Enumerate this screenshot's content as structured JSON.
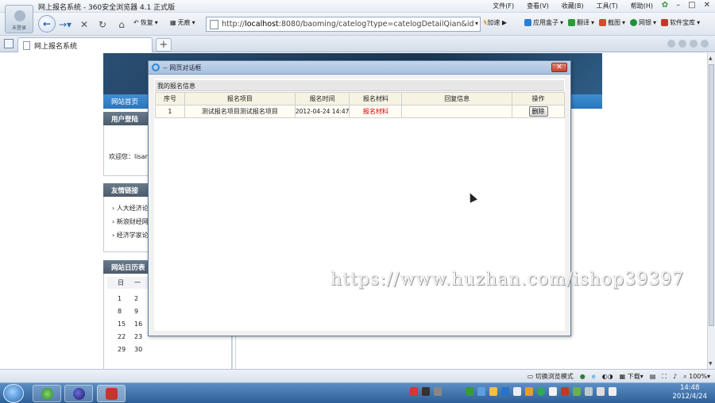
{
  "browser": {
    "title": "网上报名系统 - 360安全浏览器 4.1 正式版",
    "menu": [
      "文件(F)",
      "查看(V)",
      "收藏(B)",
      "工具(T)",
      "帮助(H)"
    ],
    "avatar_label": "未登录",
    "back_icon": "back-arrow-icon",
    "forward_icon": "forward-arrow-icon",
    "stop_glyph": "✕",
    "refresh_glyph": "↻",
    "home_glyph": "⌂",
    "restore_label": "恢复",
    "trace_label": "无痕",
    "address_prefix": "http://",
    "address_host": "localhost",
    "address_rest": ":8080/baoming/catelog?type=catelogDetailQian&id=",
    "speedup_label": "加速",
    "plugins": [
      {
        "label": "应用盒子",
        "color": "#2a7fd4"
      },
      {
        "label": "翻译",
        "color": "#2c9a3a"
      },
      {
        "label": "截图",
        "color": "#d64b2b"
      },
      {
        "label": "网银",
        "color": "#1e8f3a"
      },
      {
        "label": "软件宝库",
        "color": "#c0392b"
      }
    ],
    "tab_title": "网上报名系统",
    "new_tab_glyph": "+"
  },
  "site": {
    "nav_home": "网站首页",
    "login_header": "用户登陆",
    "welcome_text": "欢迎您：lisan",
    "links_header": "友情链接",
    "links": [
      "人大经济论",
      "新浪财经网",
      "经济学家论"
    ],
    "calendar_header": "网站日历表",
    "calendar_head": [
      "日",
      "一"
    ],
    "calendar_rows": [
      [
        "1",
        "2"
      ],
      [
        "8",
        "9"
      ],
      [
        "15",
        "16"
      ],
      [
        "22",
        "23"
      ],
      [
        "29",
        "30"
      ]
    ]
  },
  "dialog": {
    "title": "-- 网页对话框",
    "close_glyph": "✕",
    "section_title": "我的报名信息",
    "columns": [
      "序号",
      "报名项目",
      "报名时间",
      "报名材料",
      "回复信息",
      "操作"
    ],
    "rows": [
      {
        "index": "1",
        "project": "测试报名项目测试报名项目",
        "time": "2012-04-24 14:47",
        "material": "报名材料",
        "reply": "",
        "action": "删除"
      }
    ]
  },
  "watermark": "https://www.huzhan.com/ishop39397",
  "statusbar": {
    "mode_label": "切换浏览模式",
    "download_label": "下载",
    "zoom": "100%"
  },
  "taskbar": {
    "time": "14:48",
    "date": "2012/4/24"
  },
  "colors": {
    "accent": "#2b75bb",
    "material_link": "#d40000",
    "dialog_border": "#5b7da5"
  }
}
